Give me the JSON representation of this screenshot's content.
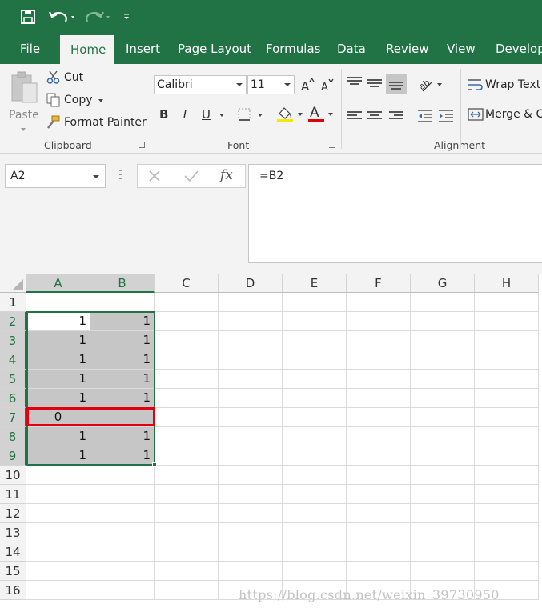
{
  "qat": {
    "save_icon": "save-icon",
    "undo_icon": "undo-icon",
    "redo_icon": "redo-icon",
    "customize_icon": "customize-qat-icon"
  },
  "tabs": [
    {
      "label": "File"
    },
    {
      "label": "Home"
    },
    {
      "label": "Insert"
    },
    {
      "label": "Page Layout"
    },
    {
      "label": "Formulas"
    },
    {
      "label": "Data"
    },
    {
      "label": "Review"
    },
    {
      "label": "View"
    },
    {
      "label": "Develop"
    }
  ],
  "ribbon": {
    "clipboard": {
      "paste": "Paste",
      "cut": "Cut",
      "copy": "Copy",
      "format_painter": "Format Painter",
      "label": "Clipboard"
    },
    "font": {
      "family": "Calibri",
      "size": "11",
      "bold": "B",
      "italic": "I",
      "underline": "U",
      "font_color_letter": "A",
      "label": "Font"
    },
    "alignment": {
      "wrap_text": "Wrap Text",
      "merge": "Merge & C",
      "label": "Alignment"
    }
  },
  "formula_bar": {
    "name_box": "A2",
    "fx": "fx",
    "formula": "=B2"
  },
  "sheet": {
    "columns": [
      "A",
      "B",
      "C",
      "D",
      "E",
      "F",
      "G",
      "H"
    ],
    "rows": [
      "1",
      "2",
      "3",
      "4",
      "5",
      "6",
      "7",
      "8",
      "9",
      "10",
      "11",
      "12",
      "13",
      "14",
      "15",
      "16"
    ],
    "colA": [
      "",
      "1",
      "1",
      "1",
      "1",
      "1",
      "0",
      "1",
      "1"
    ],
    "colB": [
      "",
      "1",
      "1",
      "1",
      "1",
      "1",
      "",
      "1",
      "1"
    ]
  },
  "watermark": "https://blog.csdn.net/weixin_39730950",
  "colors": {
    "accent": "#217346",
    "highlight_border": "#e0000f",
    "selection_shade": "#c6c6c6"
  }
}
